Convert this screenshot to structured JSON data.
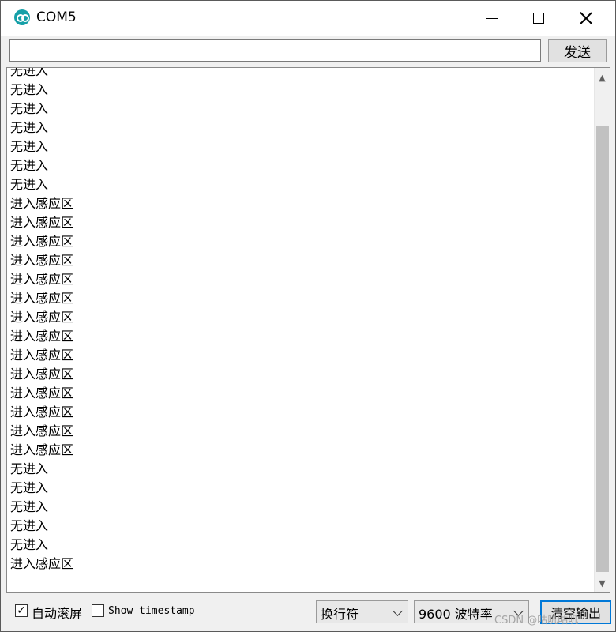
{
  "window": {
    "title": "COM5"
  },
  "input": {
    "value": "",
    "send_label": "发送"
  },
  "output": {
    "lines": [
      "无进入",
      "无进入",
      "无进入",
      "无进入",
      "无进入",
      "无进入",
      "无进入",
      "进入感应区",
      "进入感应区",
      "进入感应区",
      "进入感应区",
      "进入感应区",
      "进入感应区",
      "进入感应区",
      "进入感应区",
      "进入感应区",
      "进入感应区",
      "进入感应区",
      "进入感应区",
      "进入感应区",
      "进入感应区",
      "无进入",
      "无进入",
      "无进入",
      "无进入",
      "无进入",
      "进入感应区"
    ]
  },
  "footer": {
    "autoscroll_label": "自动滚屏",
    "autoscroll_checked": true,
    "timestamp_label": "Show timestamp",
    "timestamp_checked": false,
    "line_ending": "换行符",
    "baud_rate": "9600 波特率",
    "clear_label": "清空输出"
  },
  "watermark": "CSDN @咕叽咕叽"
}
